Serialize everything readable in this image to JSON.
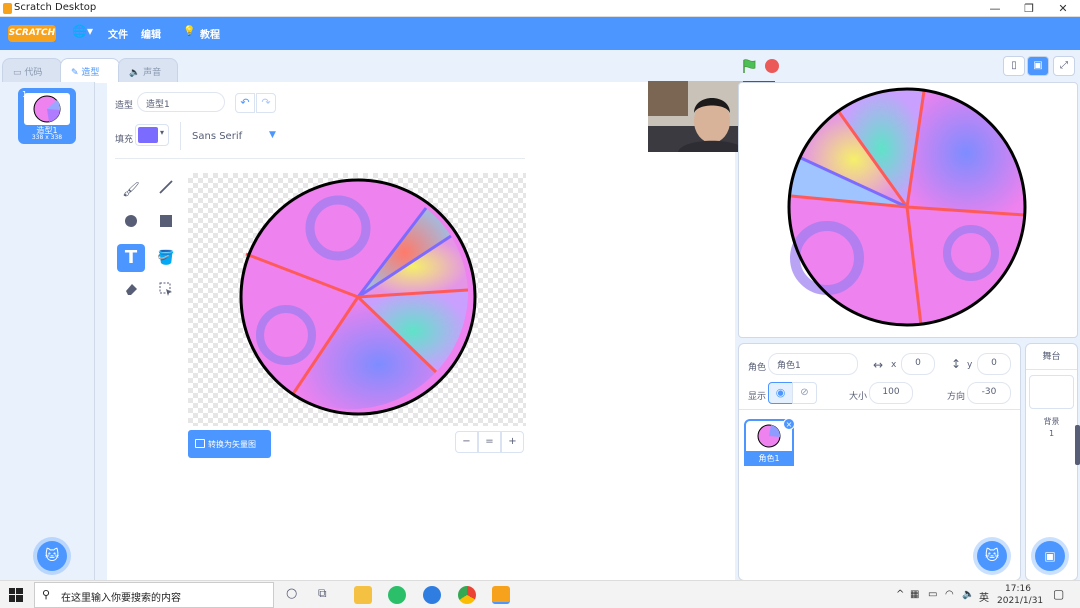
{
  "window": {
    "title": "Scratch Desktop",
    "minimize": "—",
    "maximize": "❐",
    "close": "✕"
  },
  "menu": {
    "logo": "SCRATCH",
    "globe": "🌐▾",
    "file": "文件",
    "edit": "编辑",
    "tutorials": "教程"
  },
  "tabs": {
    "code": "代码",
    "costumes": "造型",
    "sounds": "声音"
  },
  "costume": {
    "number": "1",
    "name": "造型1",
    "size": "338 x 338"
  },
  "editor": {
    "costume_label": "造型",
    "costume_name": "造型1",
    "fill_label": "填充",
    "fill_color": "#7b6bff",
    "font": "Sans Serif",
    "convert_button": "转换为矢量图",
    "zoom_out": "−",
    "zoom_reset": "=",
    "zoom_in": "+"
  },
  "tools": [
    "brush-icon",
    "line-icon",
    "circle-icon",
    "rectangle-icon",
    "text-icon",
    "fill-icon",
    "eraser-icon",
    "select-icon"
  ],
  "sprite": {
    "sprite_label": "角色",
    "sprite_name": "角色1",
    "x_label": "x",
    "x_value": "0",
    "y_label": "y",
    "y_value": "0",
    "show_label": "显示",
    "size_label": "大小",
    "size_value": "100",
    "direction_label": "方向",
    "direction_value": "-30",
    "tile_name": "角色1"
  },
  "backdrop": {
    "title": "舞台",
    "label": "背景",
    "count": "1"
  },
  "taskbar": {
    "search_placeholder": "在这里输入你要搜索的内容",
    "ime": "英",
    "time": "17:16",
    "date": "2021/1/31"
  },
  "colors": {
    "accent": "#4c97ff",
    "stop": "#ec5959",
    "flag": "#4cbf56",
    "wedge_line": "#ff5a5a",
    "pie_pink": "#ee82ee"
  }
}
